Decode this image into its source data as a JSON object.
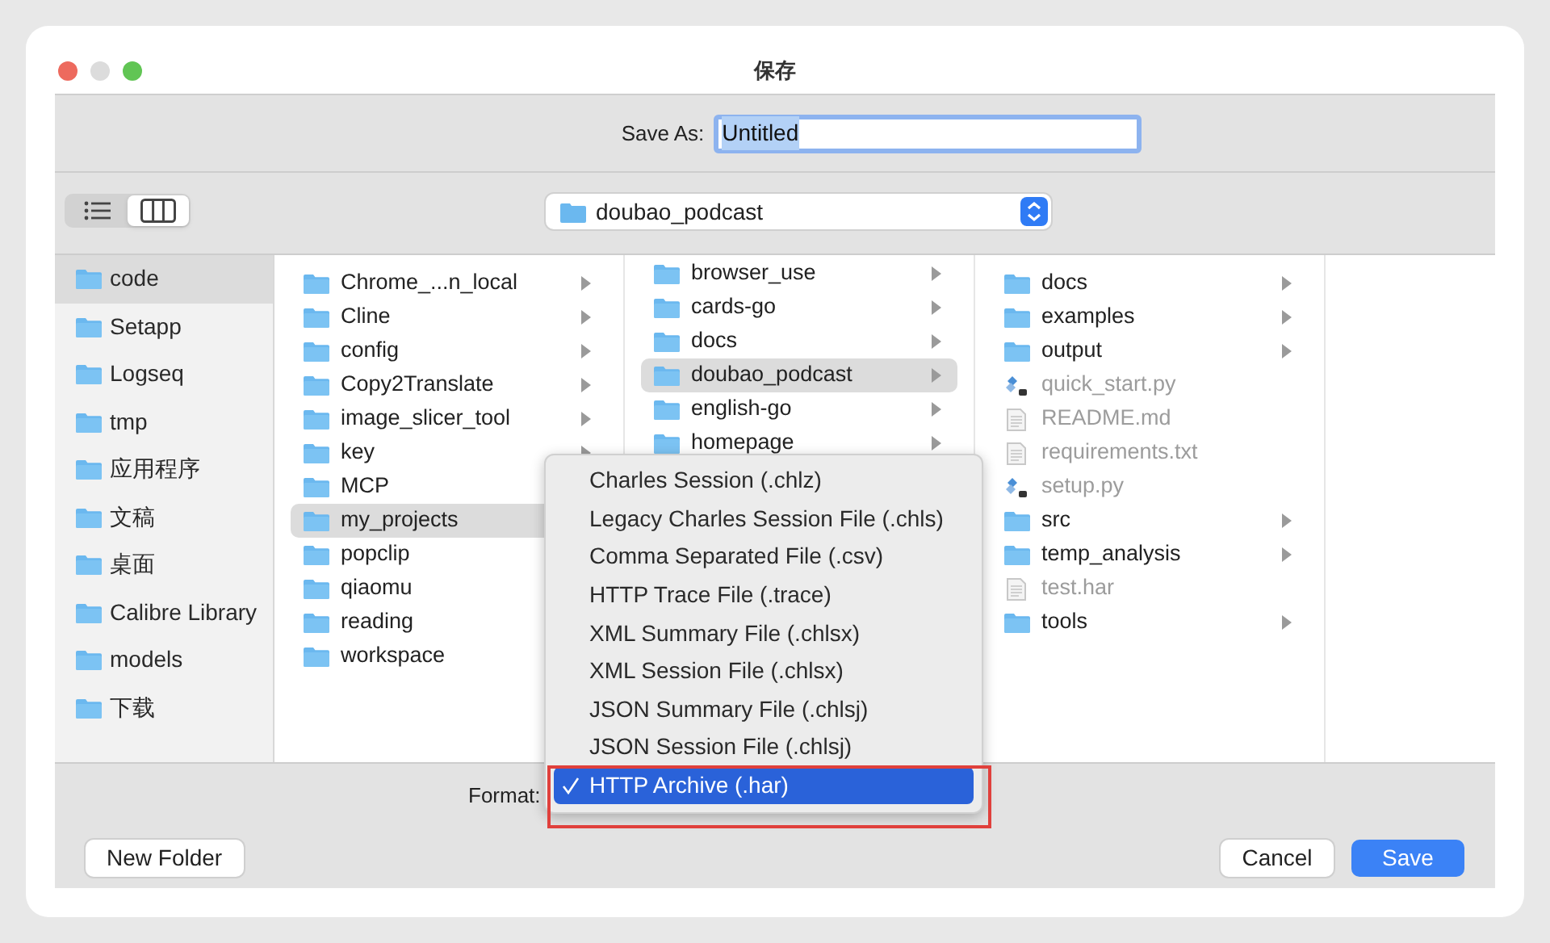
{
  "window": {
    "title": "保存"
  },
  "save_as": {
    "label": "Save As:",
    "value": "Untitled"
  },
  "view_buttons": [
    {
      "kind": "list",
      "selected": false
    },
    {
      "kind": "columns",
      "selected": true
    }
  ],
  "location": {
    "folder": "doubao_podcast"
  },
  "sidebar": {
    "items": [
      {
        "label": "code",
        "selected": true
      },
      {
        "label": "Setapp",
        "selected": false
      },
      {
        "label": "Logseq",
        "selected": false
      },
      {
        "label": "tmp",
        "selected": false
      },
      {
        "label": "应用程序",
        "selected": false
      },
      {
        "label": "文稿",
        "selected": false
      },
      {
        "label": "桌面",
        "selected": false
      },
      {
        "label": "Calibre Library",
        "selected": false
      },
      {
        "label": "models",
        "selected": false
      },
      {
        "label": "下载",
        "selected": false
      }
    ]
  },
  "columns": [
    {
      "items": [
        {
          "name": "Chrome_...n_local",
          "kind": "folder",
          "selected": false,
          "disabled": false
        },
        {
          "name": "Cline",
          "kind": "folder",
          "selected": false,
          "disabled": false
        },
        {
          "name": "config",
          "kind": "folder",
          "selected": false,
          "disabled": false
        },
        {
          "name": "Copy2Translate",
          "kind": "folder",
          "selected": false,
          "disabled": false
        },
        {
          "name": "image_slicer_tool",
          "kind": "folder",
          "selected": false,
          "disabled": false
        },
        {
          "name": "key",
          "kind": "folder",
          "selected": false,
          "disabled": false
        },
        {
          "name": "MCP",
          "kind": "folder",
          "selected": false,
          "disabled": false
        },
        {
          "name": "my_projects",
          "kind": "folder",
          "selected": true,
          "disabled": false
        },
        {
          "name": "popclip",
          "kind": "folder",
          "selected": false,
          "disabled": false
        },
        {
          "name": "qiaomu",
          "kind": "folder",
          "selected": false,
          "disabled": false
        },
        {
          "name": "reading",
          "kind": "folder",
          "selected": false,
          "disabled": false
        },
        {
          "name": "workspace",
          "kind": "folder",
          "selected": false,
          "disabled": false
        }
      ]
    },
    {
      "items": [
        {
          "name": "browser_use",
          "kind": "folder",
          "selected": false,
          "disabled": false
        },
        {
          "name": "cards-go",
          "kind": "folder",
          "selected": false,
          "disabled": false
        },
        {
          "name": "docs",
          "kind": "folder",
          "selected": false,
          "disabled": false
        },
        {
          "name": "doubao_podcast",
          "kind": "folder",
          "selected": true,
          "disabled": false
        },
        {
          "name": "english-go",
          "kind": "folder",
          "selected": false,
          "disabled": false
        },
        {
          "name": "homepage",
          "kind": "folder",
          "selected": false,
          "disabled": false
        }
      ]
    },
    {
      "items": [
        {
          "name": "docs",
          "kind": "folder",
          "selected": false,
          "disabled": false
        },
        {
          "name": "examples",
          "kind": "folder",
          "selected": false,
          "disabled": false
        },
        {
          "name": "output",
          "kind": "folder",
          "selected": false,
          "disabled": false
        },
        {
          "name": "quick_start.py",
          "kind": "script",
          "selected": false,
          "disabled": true
        },
        {
          "name": "README.md",
          "kind": "document",
          "selected": false,
          "disabled": true
        },
        {
          "name": "requirements.txt",
          "kind": "document",
          "selected": false,
          "disabled": true
        },
        {
          "name": "setup.py",
          "kind": "script",
          "selected": false,
          "disabled": true
        },
        {
          "name": "src",
          "kind": "folder",
          "selected": false,
          "disabled": false
        },
        {
          "name": "temp_analysis",
          "kind": "folder",
          "selected": false,
          "disabled": false
        },
        {
          "name": "test.har",
          "kind": "document",
          "selected": false,
          "disabled": true
        },
        {
          "name": "tools",
          "kind": "folder",
          "selected": false,
          "disabled": false
        }
      ]
    }
  ],
  "format": {
    "label": "Format:",
    "highlighted": true,
    "menu": [
      {
        "label": "Charles Session (.chlz)",
        "selected": false
      },
      {
        "label": "Legacy Charles Session File (.chls)",
        "selected": false
      },
      {
        "label": "Comma Separated File (.csv)",
        "selected": false
      },
      {
        "label": "HTTP Trace File (.trace)",
        "selected": false
      },
      {
        "label": "XML Summary File (.chlsx)",
        "selected": false
      },
      {
        "label": "XML Session File (.chlsx)",
        "selected": false
      },
      {
        "label": "JSON Summary File (.chlsj)",
        "selected": false
      },
      {
        "label": "JSON Session File (.chlsj)",
        "selected": false
      },
      {
        "label": "HTTP Archive (.har)",
        "selected": true
      }
    ]
  },
  "buttons": [
    {
      "label": "New Folder",
      "kind": "secondary"
    },
    {
      "label": "Cancel",
      "kind": "secondary"
    },
    {
      "label": "Save",
      "kind": "primary"
    }
  ]
}
